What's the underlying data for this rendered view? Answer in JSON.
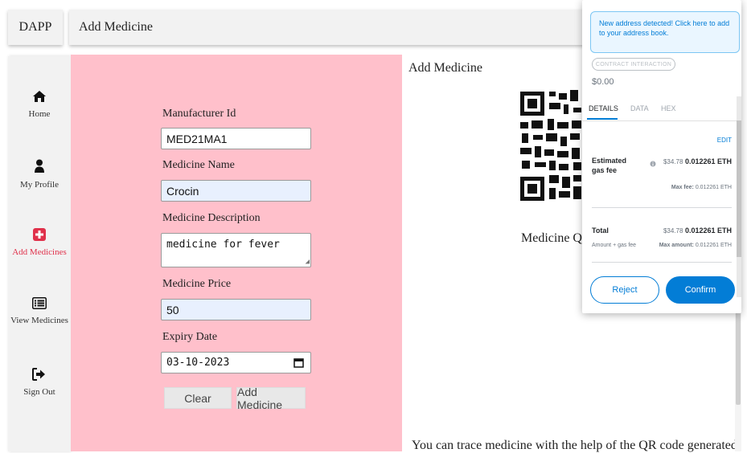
{
  "app": {
    "brand": "DAPP",
    "page_title": "Add Medicine"
  },
  "sidebar": {
    "items": [
      {
        "label": "Home",
        "icon": "home-icon"
      },
      {
        "label": "My Profile",
        "icon": "user-icon"
      },
      {
        "label": "Add Medicines",
        "icon": "plus-square-icon",
        "active": true
      },
      {
        "label": "View Medicines",
        "icon": "list-icon"
      },
      {
        "label": "Sign Out",
        "icon": "sign-out-icon"
      }
    ],
    "active_color": "#e0314b"
  },
  "form": {
    "manufacturer_label": "Manufacturer Id",
    "manufacturer_value": "MED21MA1",
    "name_label": "Medicine Name",
    "name_value": "Crocin",
    "description_label": "Medicine Description",
    "description_value": "medicine for fever",
    "price_label": "Medicine Price",
    "price_value": "50",
    "expiry_label": "Expiry Date",
    "expiry_value": "03-10-2023",
    "clear_label": "Clear",
    "submit_label": "Add Medicine",
    "panel_color": "#ffc0cb"
  },
  "content": {
    "title": "Add Medicine",
    "qr_caption": "Medicine QI",
    "trace_text": "You can trace medicine with the help of the QR code generated"
  },
  "metamask": {
    "notice": "New address detected! Click here to add to your address book.",
    "contract_tag": "CONTRACT INTERACTION",
    "amount": "$0.00",
    "tabs": [
      "DETAILS",
      "DATA",
      "HEX"
    ],
    "edit_label": "EDIT",
    "gas_label": "Estimated gas fee",
    "gas_usd": "$34.78",
    "gas_eth": "0.012261 ETH",
    "max_fee_label": "Max fee:",
    "max_fee_value": "0.012261 ETH",
    "total_label": "Total",
    "total_usd": "$34.78",
    "total_eth": "0.012261 ETH",
    "total_sub": "Amount + gas fee",
    "max_amount_label": "Max amount:",
    "max_amount_value": "0.012261 ETH",
    "reject_label": "Reject",
    "confirm_label": "Confirm",
    "accent": "#037dd6"
  }
}
